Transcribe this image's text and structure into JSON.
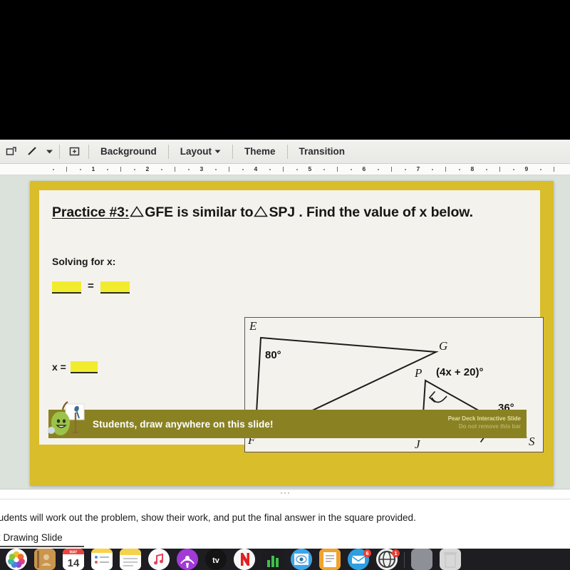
{
  "toolbar": {
    "icons": [
      {
        "name": "shape-tool-icon",
        "glyph": "shape"
      },
      {
        "name": "line-tool-icon",
        "glyph": "line"
      },
      {
        "name": "line-tool-dropdown-icon",
        "glyph": "caret"
      },
      {
        "name": "insert-textbox-icon",
        "glyph": "textbox"
      }
    ],
    "items": [
      {
        "label": "Background",
        "has_caret": false
      },
      {
        "label": "Layout",
        "has_caret": true
      },
      {
        "label": "Theme",
        "has_caret": false
      },
      {
        "label": "Transition",
        "has_caret": false
      }
    ]
  },
  "ruler": {
    "numbers": [
      "1",
      "2",
      "3",
      "4",
      "5",
      "6",
      "7",
      "8",
      "9"
    ]
  },
  "slide": {
    "border_color": "#d9bd2a",
    "background_color": "#f4f2ec",
    "title": {
      "prefix": "Practice #3:",
      "segment_1": "GFE is similar to",
      "segment_2": "SPJ . Find the value of x below."
    },
    "solving_label": "Solving for x:",
    "proportion": {
      "left_blank": "",
      "equals": "=",
      "right_blank": ""
    },
    "answer": {
      "label": "x =",
      "value": ""
    },
    "figure": {
      "big_triangle": {
        "vertices": [
          "E",
          "F",
          "G"
        ],
        "angle_label": "80°"
      },
      "small_triangle": {
        "vertices": [
          "P",
          "J",
          "S"
        ],
        "angle_label_p": "(4x + 20)°",
        "angle_label_s": "36°"
      }
    },
    "peardeck": {
      "message": "Students, draw anywhere on this slide!",
      "brand_line1": "Pear Deck Interactive Slide",
      "brand_line2": "Do not remove this bar",
      "bar_color": "#8a8222"
    }
  },
  "notes": {
    "line1": "tudents will work out the problem, show their work, and put the final answer in the square provided.",
    "line2": "k Drawing Slide"
  },
  "dock": {
    "items": [
      {
        "name": "photos",
        "color": "#ffffff",
        "glyph": "photos",
        "badge": ""
      },
      {
        "name": "contacts",
        "color": "#c48a4a",
        "glyph": "contacts",
        "badge": ""
      },
      {
        "name": "calendar",
        "color": "#ffffff",
        "glyph": "calendar",
        "badge": "",
        "day": "14",
        "month": "MAY"
      },
      {
        "name": "notes-app",
        "color": "#fdfdfd",
        "glyph": "notes",
        "badge": ""
      },
      {
        "name": "reminders",
        "color": "#fdfdfd",
        "glyph": "reminders",
        "badge": ""
      },
      {
        "name": "music",
        "color": "#fbfbfb",
        "glyph": "music",
        "badge": ""
      },
      {
        "name": "podcasts",
        "color": "#a13ad6",
        "glyph": "podcasts",
        "badge": ""
      },
      {
        "name": "tv",
        "color": "#1c1c1c",
        "glyph": "tv",
        "badge": ""
      },
      {
        "name": "netflix",
        "color": "#f7f7f7",
        "glyph": "netflix",
        "badge": ""
      },
      {
        "name": "numbers",
        "color": "#1b1b20",
        "glyph": "numbers",
        "badge": ""
      },
      {
        "name": "preview",
        "color": "#3da4e8",
        "glyph": "preview",
        "badge": ""
      },
      {
        "name": "pages",
        "color": "#f0a32c",
        "glyph": "pages",
        "badge": ""
      },
      {
        "name": "mail",
        "color": "#2e9fe0",
        "glyph": "mail",
        "badge": "6"
      },
      {
        "name": "chrome",
        "color": "#f0f0f0",
        "glyph": "chrome",
        "badge": "1"
      },
      {
        "name": "separator",
        "color": "",
        "glyph": "separator",
        "badge": ""
      },
      {
        "name": "downloads",
        "color": "#8d9096",
        "glyph": "downloads",
        "badge": ""
      },
      {
        "name": "trash",
        "color": "#d8d8d8",
        "glyph": "trash",
        "badge": ""
      }
    ]
  }
}
